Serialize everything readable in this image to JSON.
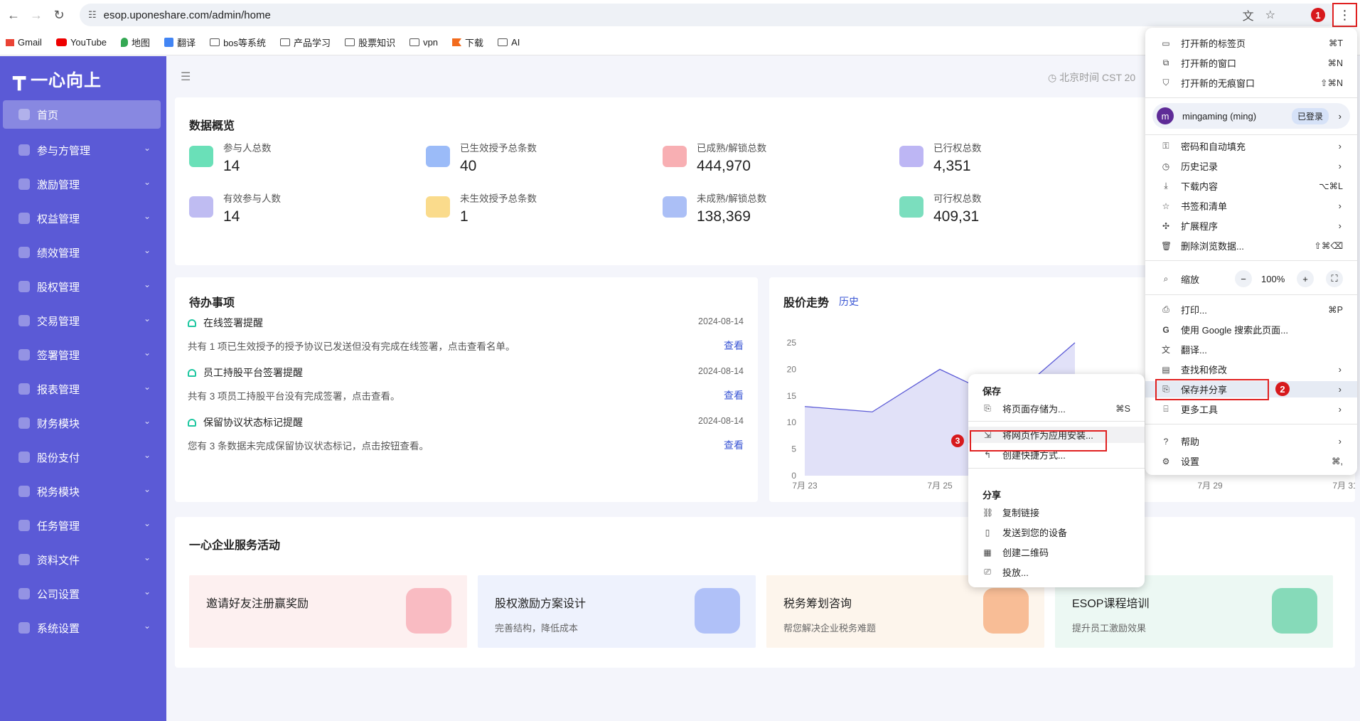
{
  "browser": {
    "url": "esop.uponeshare.com/admin/home",
    "badges": [
      "1",
      "2",
      "3"
    ]
  },
  "bookmarks": [
    {
      "label": "Gmail",
      "color": "#ea4335"
    },
    {
      "label": "YouTube",
      "color": "#e00"
    },
    {
      "label": "地图",
      "color": "#34a853"
    },
    {
      "label": "翻译",
      "color": "#4285f4"
    },
    {
      "label": "bos等系统",
      "color": "folder"
    },
    {
      "label": "产品学习",
      "color": "folder"
    },
    {
      "label": "股票知识",
      "color": "folder"
    },
    {
      "label": "vpn",
      "color": "folder"
    },
    {
      "label": "下载",
      "color": "#f26b1d"
    },
    {
      "label": "AI",
      "color": "folder"
    }
  ],
  "sidebar": {
    "logo": "一心向上",
    "items": [
      {
        "label": "首页"
      },
      {
        "label": "参与方管理"
      },
      {
        "label": "激励管理"
      },
      {
        "label": "权益管理"
      },
      {
        "label": "绩效管理"
      },
      {
        "label": "股权管理"
      },
      {
        "label": "交易管理"
      },
      {
        "label": "签署管理"
      },
      {
        "label": "报表管理"
      },
      {
        "label": "财务模块"
      },
      {
        "label": "股份支付"
      },
      {
        "label": "税务模块"
      },
      {
        "label": "任务管理"
      },
      {
        "label": "资料文件"
      },
      {
        "label": "公司设置"
      },
      {
        "label": "系统设置"
      }
    ]
  },
  "header": {
    "time": "北京时间 CST 20"
  },
  "overview": {
    "title": "数据概览",
    "stats": [
      {
        "label": "参与人总数",
        "value": "14",
        "color": "#38d6a0"
      },
      {
        "label": "已生效授予总条数",
        "value": "40",
        "color": "#7aa4f5"
      },
      {
        "label": "已成熟/解锁总数",
        "value": "444,970",
        "color": "#f6949a"
      },
      {
        "label": "已行权总数",
        "value": "4,351",
        "color": "#a79df0"
      },
      {
        "label": "有效参与人数",
        "value": "14",
        "color": "#a9a6ee"
      },
      {
        "label": "未生效授予总条数",
        "value": "1",
        "color": "#f8cf66"
      },
      {
        "label": "未成熟/解锁总数",
        "value": "138,369",
        "color": "#8fa9f3"
      },
      {
        "label": "可行权总数",
        "value": "409,31",
        "color": "#4fd3a8"
      }
    ]
  },
  "todo": {
    "title": "待办事项",
    "items": [
      {
        "title": "在线签署提醒",
        "date": "2024-08-14",
        "desc": "共有 1 项已生效授予的授予协议已发送但没有完成在线签署，点击查看名单。",
        "link": "查看"
      },
      {
        "title": "员工持股平台签署提醒",
        "date": "2024-08-14",
        "desc": "共有 3 项员工持股平台没有完成签署，点击查看。",
        "link": "查看"
      },
      {
        "title": "保留协议状态标记提醒",
        "date": "2024-08-14",
        "desc": "您有 3 条数据未完成保留协议状态标记，点击按钮查看。",
        "link": "查看"
      }
    ]
  },
  "stock": {
    "title": "股价走势",
    "history": "历史"
  },
  "chart_data": {
    "type": "area",
    "title": "股价走势",
    "x": [
      "7月 23",
      "7月 24",
      "7月 25",
      "7月 26",
      "7月 27",
      "7月 28",
      "7月 29",
      "7月 30",
      "7月 31"
    ],
    "x_ticks": [
      "7月 23",
      "7月 25",
      "7月 27",
      "7月 29",
      "7月 31"
    ],
    "y_ticks": [
      "0",
      "5",
      "10",
      "15",
      "20",
      "25"
    ],
    "ylim": [
      0,
      25
    ],
    "values": [
      13,
      12,
      20,
      14,
      25,
      null,
      null,
      null,
      null
    ],
    "color": "#5b5ad6"
  },
  "activities": {
    "title": "一心企业服务活动",
    "items": [
      {
        "title": "邀请好友注册赢奖励",
        "sub": "",
        "bg": "#fdf0f0",
        "deco": "#f7a9b3"
      },
      {
        "title": "股权激励方案设计",
        "sub": "完善结构，降低成本",
        "bg": "#eef2fd",
        "deco": "#9bb0f6"
      },
      {
        "title": "税务筹划咨询",
        "sub": "帮您解决企业税务难题",
        "bg": "#fdf5ec",
        "deco": "#f5a97a"
      },
      {
        "title": "ESOP课程培训",
        "sub": "提升员工激励效果",
        "bg": "#ecf8f3",
        "deco": "#64d0a6"
      }
    ]
  },
  "chrome_menu": {
    "new_tab": {
      "label": "打开新的标签页",
      "sc": "⌘T"
    },
    "new_window": {
      "label": "打开新的窗口",
      "sc": "⌘N"
    },
    "incognito": {
      "label": "打开新的无痕窗口",
      "sc": "⇧⌘N"
    },
    "profile": {
      "name": "mingaming (ming)",
      "status": "已登录",
      "avatar": "m"
    },
    "passwords": "密码和自动填充",
    "history": "历史记录",
    "downloads": {
      "label": "下载内容",
      "sc": "⌥⌘L"
    },
    "bookmarks": "书签和清单",
    "extensions": "扩展程序",
    "clear": {
      "label": "删除浏览数据...",
      "sc": "⇧⌘⌫"
    },
    "zoom": {
      "label": "缩放",
      "value": "100%",
      "minus": "−",
      "plus": "+"
    },
    "print": {
      "label": "打印...",
      "sc": "⌘P"
    },
    "google": "使用 Google 搜索此页面...",
    "translate": "翻译...",
    "find": "查找和修改",
    "save_share": "保存并分享",
    "more_tools": "更多工具",
    "help": "帮助",
    "settings": {
      "label": "设置",
      "sc": "⌘,"
    }
  },
  "sub_menu": {
    "save_header": "保存",
    "save_page": {
      "label": "将页面存储为...",
      "sc": "⌘S"
    },
    "install": "将网页作为应用安装...",
    "shortcut": "创建快捷方式...",
    "share_header": "分享",
    "copy_link": "复制链接",
    "send_device": "发送到您的设备",
    "qr": "创建二维码",
    "cast": "投放..."
  }
}
